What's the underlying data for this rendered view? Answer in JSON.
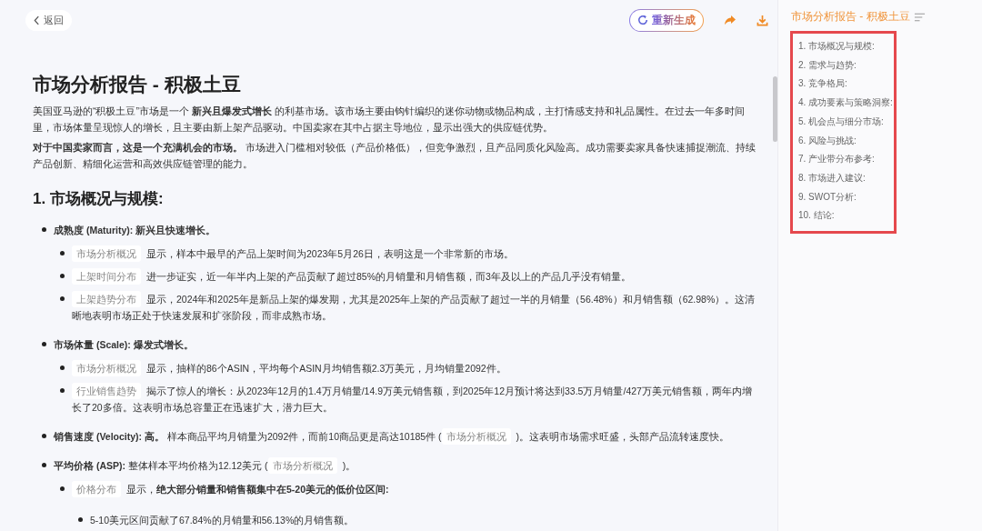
{
  "header": {
    "back_label": "返回",
    "regenerate_label": "重新生成"
  },
  "report": {
    "title": "市场分析报告 - 积极土豆",
    "paragraphs": [
      "美国亚马逊的“积极土豆”市场是一个 **新兴且爆发式增长** 的利基市场。该市场主要由钩针编织的迷你动物或物品构成，主打情感支持和礼品属性。在过去一年多时间里，市场体量呈现惊人的增长，且主要由新上架产品驱动。中国卖家在其中占据主导地位，显示出强大的供应链优势。",
      "**对于中国卖家而言，这是一个充满机会的市场。** 市场进入门槛相对较低（产品价格低），但竞争激烈，且产品同质化风险高。成功需要卖家具备快速捕捉潮流、持续产品创新、精细化运营和高效供应链管理的能力。"
    ],
    "sections": [
      {
        "heading": "1. 市场概况与规模:",
        "items": [
          {
            "lead": "成熟度 (Maturity): 新兴且快速增长。",
            "children": [
              {
                "parts": [
                  {
                    "kind": "chip",
                    "text": "市场分析概况"
                  },
                  {
                    "kind": "text",
                    "text": "显示，样本中最早的产品上架时间为2023年5月26日，表明这是一个非常新的市场。"
                  }
                ]
              },
              {
                "parts": [
                  {
                    "kind": "chip",
                    "text": "上架时间分布"
                  },
                  {
                    "kind": "text",
                    "text": "进一步证实，近一年半内上架的产品贡献了超过85%的月销量和月销售额，而3年及以上的产品几乎没有销量。"
                  }
                ]
              },
              {
                "parts": [
                  {
                    "kind": "chip",
                    "text": "上架趋势分布"
                  },
                  {
                    "kind": "text",
                    "text": "显示，2024年和2025年是新品上架的爆发期，尤其是2025年上架的产品贡献了超过一半的月销量（56.48%）和月销售额（62.98%）。这清晰地表明市场正处于快速发展和扩张阶段，而非成熟市场。"
                  }
                ]
              }
            ]
          },
          {
            "lead": "市场体量 (Scale): 爆发式增长。",
            "children": [
              {
                "parts": [
                  {
                    "kind": "chip",
                    "text": "市场分析概况"
                  },
                  {
                    "kind": "text",
                    "text": "显示，抽样的86个ASIN，平均每个ASIN月均销售额2.3万美元，月均销量2092件。"
                  }
                ]
              },
              {
                "parts": [
                  {
                    "kind": "chip",
                    "text": "行业销售趋势"
                  },
                  {
                    "kind": "text",
                    "text": "揭示了惊人的增长：从2023年12月的1.4万月销量/14.9万美元销售额，到2025年12月预计将达到33.5万月销量/427万美元销售额，两年内增长了20多倍。这表明市场总容量正在迅速扩大，潜力巨大。"
                  }
                ]
              }
            ]
          },
          {
            "lead": "销售速度 (Velocity): 高。",
            "parts": [
              {
                "kind": "text",
                "text": "样本商品平均月销量为2092件，而前10商品更是高达10185件 ("
              },
              {
                "kind": "chip",
                "text": "市场分析概况"
              },
              {
                "kind": "text",
                "text": ")。这表明市场需求旺盛，头部产品流转速度快。"
              }
            ]
          },
          {
            "lead": "平均价格 (ASP):",
            "parts": [
              {
                "kind": "text",
                "text": "整体样本平均价格为12.12美元 ("
              },
              {
                "kind": "chip",
                "text": "市场分析概况"
              },
              {
                "kind": "text",
                "text": ")。"
              }
            ],
            "children": [
              {
                "parts": [
                  {
                    "kind": "chip",
                    "text": "价格分布"
                  },
                  {
                    "kind": "text",
                    "text": "显示，**绝大部分销量和销售额集中在5-20美元的低价位区间:**"
                  }
                ],
                "children": [
                  {
                    "parts": [
                      {
                        "kind": "text",
                        "text": "5-10美元区间贡献了67.84%的月销量和56.13%的月销售额。"
                      }
                    ]
                  }
                ]
              }
            ]
          }
        ]
      }
    ]
  },
  "outline": {
    "title": "市场分析报告 - 积极土豆",
    "items": [
      "1. 市场概况与规模:",
      "2. 需求与趋势:",
      "3. 竞争格局:",
      "4. 成功要素与策略洞察:",
      "5. 机会点与细分市场:",
      "6. 风险与挑战:",
      "7. 产业带分布参考:",
      "8. 市场进入建议:",
      "9. SWOT分析:",
      "10. 结论:"
    ]
  }
}
